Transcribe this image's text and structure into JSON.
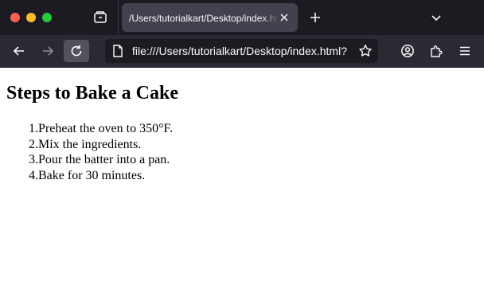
{
  "browser": {
    "tab": {
      "title": "/Users/tutorialkart/Desktop/index.html"
    },
    "urlbar": {
      "url": "file:///Users/tutorialkart/Desktop/index.html?"
    },
    "colors": {
      "titlebar": "#1c1b22",
      "toolbar": "#2b2a33",
      "active_tab": "#42414d",
      "icon": "#fbfbfe"
    }
  },
  "page": {
    "heading": "Steps to Bake a Cake",
    "steps": [
      {
        "number": "1.",
        "text": "Preheat the oven to 350°F."
      },
      {
        "number": "2.",
        "text": "Mix the ingredients."
      },
      {
        "number": "3.",
        "text": "Pour the batter into a pan."
      },
      {
        "number": "4.",
        "text": "Bake for 30 minutes."
      }
    ]
  }
}
